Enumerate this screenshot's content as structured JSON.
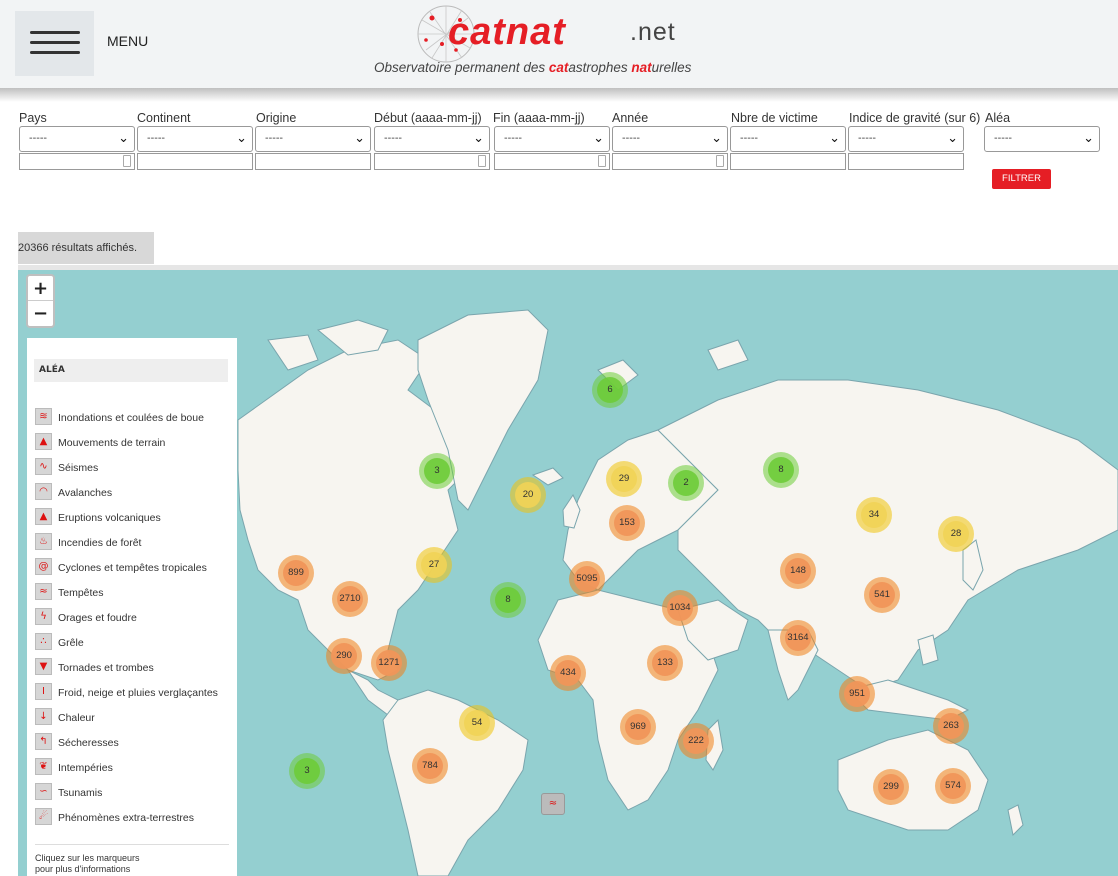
{
  "header": {
    "menu_label": "MENU",
    "logo_main": "catnat",
    "logo_suffix": ".net",
    "tagline_1": "Observatoire permanent des ",
    "tagline_2": "cat",
    "tagline_3": "astrophes ",
    "tagline_4": "nat",
    "tagline_5": "urelles"
  },
  "filters": [
    {
      "label": "Pays",
      "value": "-----"
    },
    {
      "label": "Continent",
      "value": "-----"
    },
    {
      "label": "Origine",
      "value": "-----"
    },
    {
      "label": "Début (aaaa-mm-jj)",
      "value": "-----"
    },
    {
      "label": "Fin (aaaa-mm-jj)",
      "value": "-----"
    },
    {
      "label": "Année",
      "value": "-----"
    },
    {
      "label": "Nbre de victime",
      "value": "-----"
    },
    {
      "label": "Indice de gravité (sur 6)",
      "value": "-----"
    },
    {
      "label": "Aléa",
      "value": "-----"
    }
  ],
  "filter_button": "FILTRER",
  "results_text": "20366 résultats affichés.",
  "map": {
    "zoom_in": "+",
    "zoom_out": "−",
    "legend_title": "ALÉA",
    "legend_items": [
      "Inondations et coulées de boue",
      "Mouvements de terrain",
      "Séismes",
      "Avalanches",
      "Eruptions volcaniques",
      "Incendies de forêt",
      "Cyclones et tempêtes tropicales",
      "Tempêtes",
      "Orages et foudre",
      "Grêle",
      "Tornades et trombes",
      "Froid, neige et pluies verglaçantes",
      "Chaleur",
      "Sécheresses",
      "Intempéries",
      "Tsunamis",
      "Phénomènes extra-terrestres"
    ],
    "legend_note_1": "Cliquez sur les marqueurs",
    "legend_note_2": "pour plus d'informations",
    "clusters": [
      {
        "count": "6",
        "level": "green"
      },
      {
        "count": "3",
        "level": "green"
      },
      {
        "count": "20",
        "level": "yellow"
      },
      {
        "count": "29",
        "level": "yellow"
      },
      {
        "count": "2",
        "level": "green"
      },
      {
        "count": "8",
        "level": "green"
      },
      {
        "count": "153",
        "level": "orange"
      },
      {
        "count": "34",
        "level": "yellow"
      },
      {
        "count": "28",
        "level": "yellow"
      },
      {
        "count": "899",
        "level": "orange"
      },
      {
        "count": "27",
        "level": "yellow"
      },
      {
        "count": "5095",
        "level": "orange"
      },
      {
        "count": "148",
        "level": "orange"
      },
      {
        "count": "2710",
        "level": "orange"
      },
      {
        "count": "8",
        "level": "green"
      },
      {
        "count": "1034",
        "level": "orange"
      },
      {
        "count": "541",
        "level": "orange"
      },
      {
        "count": "3164",
        "level": "orange"
      },
      {
        "count": "290",
        "level": "orange"
      },
      {
        "count": "1271",
        "level": "orange"
      },
      {
        "count": "434",
        "level": "orange"
      },
      {
        "count": "133",
        "level": "orange"
      },
      {
        "count": "951",
        "level": "orange"
      },
      {
        "count": "54",
        "level": "yellow"
      },
      {
        "count": "969",
        "level": "orange"
      },
      {
        "count": "263",
        "level": "orange"
      },
      {
        "count": "222",
        "level": "orange"
      },
      {
        "count": "3",
        "level": "green"
      },
      {
        "count": "784",
        "level": "orange"
      },
      {
        "count": "299",
        "level": "orange"
      },
      {
        "count": "574",
        "level": "orange"
      }
    ]
  }
}
